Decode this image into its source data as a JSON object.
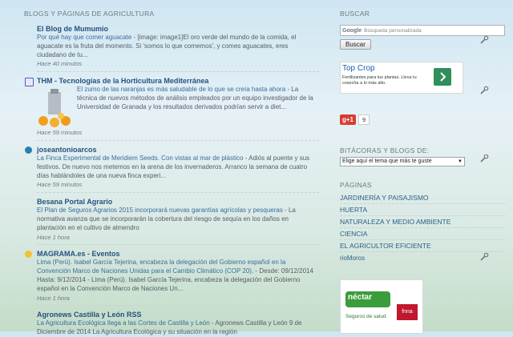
{
  "left": {
    "section_title": "BLOGS Y PÁGINAS DE AGRICULTURA",
    "blogs": [
      {
        "title": "El Blog de Mumumio",
        "link": "Por qué hay que comer aguacate",
        "text": " - [image: image1]El oro verde del mundo de la comida, el aguacate es la fruta del momento. Si 'somos lo que comemos', y comes aguacates, eres ciudadano de tu...",
        "time": "Hace 40 minutos",
        "icon": "none"
      },
      {
        "title": "THM - Tecnologías de la Horticultura Mediterránea",
        "link": "El zumo de las naranjas es más saludable de lo que se creía hasta ahora",
        "text": " - La técnica de nuevos métodos de análisis empleados por un equipo investigador de la Universidad de Granada y los resultados derivados podrían servir a diet...",
        "time": "Hace 59 minutos",
        "icon": "thm-icon"
      },
      {
        "title": "joseantonioarcos",
        "link": "La Finca Experimental de Meridiem Seeds. Con vistas al mar de plástico",
        "text": " - Adiós al puente y sus festivos. De nuevo nos metemos en la arena de los invernaderos. Arranco la semana de cuatro días hablándoles de una nueva finca experi...",
        "time": "Hace 59 minutos",
        "icon": "wordpress-icon"
      },
      {
        "title": "Besana Portal Agrario",
        "link": "El Plan de Seguros Agrarios 2015 incorporará nuevas garantías agrícolas y pesqueras",
        "text": " - La normativa avanza que se incorporarán la cobertura del riesgo de sequía en los daños en plantación en el cultivo de almendro",
        "time": "Hace 1 hora",
        "icon": "none"
      },
      {
        "title": "MAGRAMA.es - Eventos",
        "link": "Lima (Perú). Isabel García Tejerina, encabeza la delegación del Gobierno español en la Convención Marco de Naciones Unidas para el Cambio Climático (COP 20).",
        "text": " - Desde: 09/12/2014 Hasta: 9/12/2014 - Lima (Perú). Isabel García Tejerina, encabeza la delegación del Gobierno español en la Convención Marco de Naciones Un...",
        "time": "Hace 1 hora",
        "icon": "magrama-icon"
      },
      {
        "title": "Agronews Castilla y León RSS",
        "link": "La Agricultura Ecológica llega a las Cortes de Castilla y León",
        "text": " - Agronews Castilla y León 9 de Diciembre de 2014 La Agricultura Ecológica y su situación en la región",
        "time": "",
        "icon": "none"
      }
    ]
  },
  "right": {
    "search_title": "BUSCAR",
    "search_placeholder": "Búsqueda personalizada",
    "search_google": "Google",
    "search_button": "Buscar",
    "ad_title": "Top Crop",
    "ad_text": "Fertilizantes para tus plantas. Lleva tu cosecha a lo más alto.",
    "gplus_label": "g+1",
    "gplus_count": "9",
    "blogs_title": "BITÁCORAS Y BLOGS DE:",
    "blogs_select": "Elige aquí el tema que más te guste",
    "pages_title": "PÁGINAS",
    "pages": [
      "JARDINERÍA Y PAISAJISMO",
      "HUERTA",
      "NATURALEZA Y MEDIO AMBIENTE",
      "CIENCIA",
      "EL AGRICULTOR EFICIENTE"
    ],
    "pages_owner": "rioMoros",
    "ad2_brand": "néctar",
    "ad2_sub": "Seguros de salud",
    "ad2_logo": "fnna"
  }
}
